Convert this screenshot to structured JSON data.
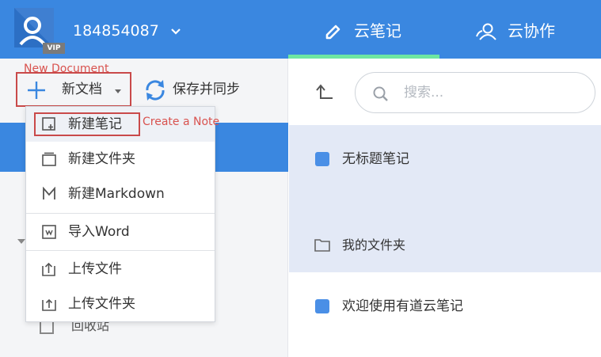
{
  "header": {
    "user_id": "184854087",
    "vip_badge": "VIP",
    "tabs": [
      {
        "label": "云笔记",
        "active": true
      },
      {
        "label": "云协作",
        "active": false
      }
    ],
    "accent_color": "#3a87e0",
    "active_underline_color": "#6ee6a2"
  },
  "toolbar": {
    "new_doc_label": "新文档",
    "save_sync_label": "保存并同步"
  },
  "annotations": {
    "new_document": "New Document",
    "create_note": "Create a Note"
  },
  "new_menu": {
    "items": [
      {
        "label": "新建笔记",
        "icon": "new-note-icon"
      },
      {
        "label": "新建文件夹",
        "icon": "folder-icon"
      },
      {
        "label": "新建Markdown",
        "icon": "markdown-icon"
      },
      {
        "label": "导入Word",
        "icon": "import-word-icon"
      },
      {
        "label": "上传文件",
        "icon": "upload-file-icon"
      },
      {
        "label": "上传文件夹",
        "icon": "upload-folder-icon"
      }
    ]
  },
  "sidebar": {
    "trash_label": "回收站"
  },
  "search": {
    "placeholder": "搜索..."
  },
  "list": {
    "items": [
      {
        "label": "无标题笔记",
        "type": "note"
      },
      {
        "label": "我的文件夹",
        "type": "folder"
      },
      {
        "label": "欢迎使用有道云笔记",
        "type": "note"
      }
    ]
  }
}
